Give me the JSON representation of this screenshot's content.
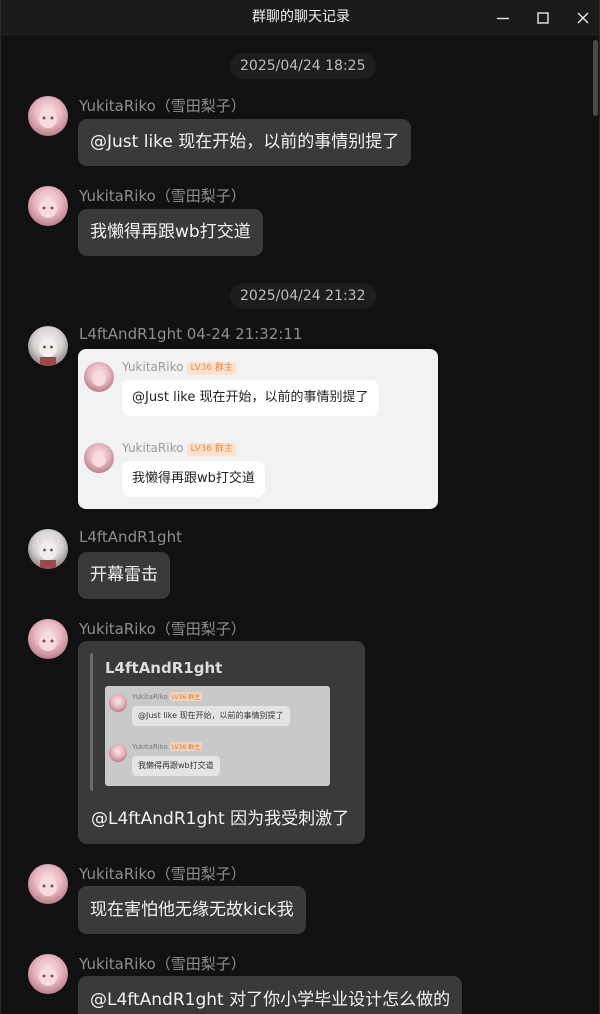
{
  "window": {
    "title": "群聊的聊天记录",
    "minimize_icon": "minimize-icon",
    "maximize_icon": "maximize-icon",
    "close_icon": "close-icon"
  },
  "timestamps": [
    "2025/04/24 18:25",
    "2025/04/24 21:32"
  ],
  "messages": [
    {
      "sender": "YukitaRiko（雪田梨子）",
      "text": "@Just like 现在开始，以前的事情别提了"
    },
    {
      "sender": "YukitaRiko（雪田梨子）",
      "text": "我懒得再跟wb打交道"
    },
    {
      "sender": "L4ftAndR1ght 04-24 21:32:11",
      "forwarded": [
        {
          "name": "YukitaRiko",
          "level": "LV36 群主",
          "text": "@Just like 现在开始，以前的事情别提了"
        },
        {
          "name": "YukitaRiko",
          "level": "LV36 群主",
          "text": "我懒得再跟wb打交道"
        }
      ]
    },
    {
      "sender": "L4ftAndR1ght",
      "text": "开幕雷击"
    },
    {
      "sender": "YukitaRiko（雪田梨子）",
      "quote_title": "L4ftAndR1ght",
      "quote_image": [
        {
          "name": "YukitaRiko",
          "level": "LV36 群主",
          "text": "@Just like 现在开始，以前的事情别提了"
        },
        {
          "name": "YukitaRiko",
          "level": "LV36 群主",
          "text": "我懒得再跟wb打交道"
        }
      ],
      "text": "@L4ftAndR1ght 因为我受刺激了"
    },
    {
      "sender": "YukitaRiko（雪田梨子）",
      "text": "现在害怕他无缘无故kick我"
    },
    {
      "sender": "YukitaRiko（雪田梨子）",
      "text": "@L4ftAndR1ght 对了你小学毕业设计怎么做的"
    }
  ],
  "colors": {
    "background": "#111111",
    "bubble": "#3a3a3a",
    "sender_name": "#8e8e8e",
    "level_badge": "#e88a4b"
  }
}
